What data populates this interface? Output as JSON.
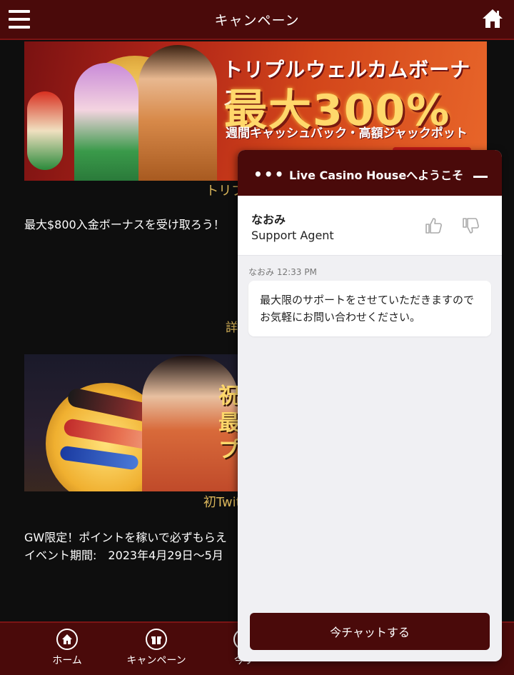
{
  "header": {
    "title": "キャンペーン"
  },
  "campaigns": [
    {
      "banner": {
        "title": "トリプルウェルカムボーナス",
        "big": "最大300%",
        "sub": "週間キャッシュバック・高額ジャックポット"
      },
      "caption": "トリプルウェルカ",
      "description": "最大$800入金ボーナスを受け取ろう！"
    },
    {
      "banner": {
        "text_lines": [
          "祝",
          "最",
          "プ"
        ]
      },
      "caption": "初Twitter企画！初",
      "description_lines": [
        "GW限定！ポイントを稼いで必ずもらえ",
        "イベント期間:　2023年4月29日〜5月"
      ]
    }
  ],
  "detail_link": "詳",
  "bottom_nav": [
    {
      "label": "ホーム",
      "icon": "home-icon"
    },
    {
      "label": "キャンペーン",
      "icon": "gift-icon"
    },
    {
      "label": "今す",
      "icon": "chat-icon"
    }
  ],
  "chat": {
    "title": "Live Casino Houseへようこそ",
    "agent_name": "なおみ",
    "agent_role": "Support Agent",
    "message_meta": "なおみ 12:33 PM",
    "message_text": "最大限のサポートをさせていただきますのでお気軽にお問い合わせください。",
    "start_button": "今チャットする"
  },
  "colors": {
    "header_bg": "#4a0a0a",
    "gold": "#d9b55a",
    "page_bg": "#0e0e0e"
  }
}
